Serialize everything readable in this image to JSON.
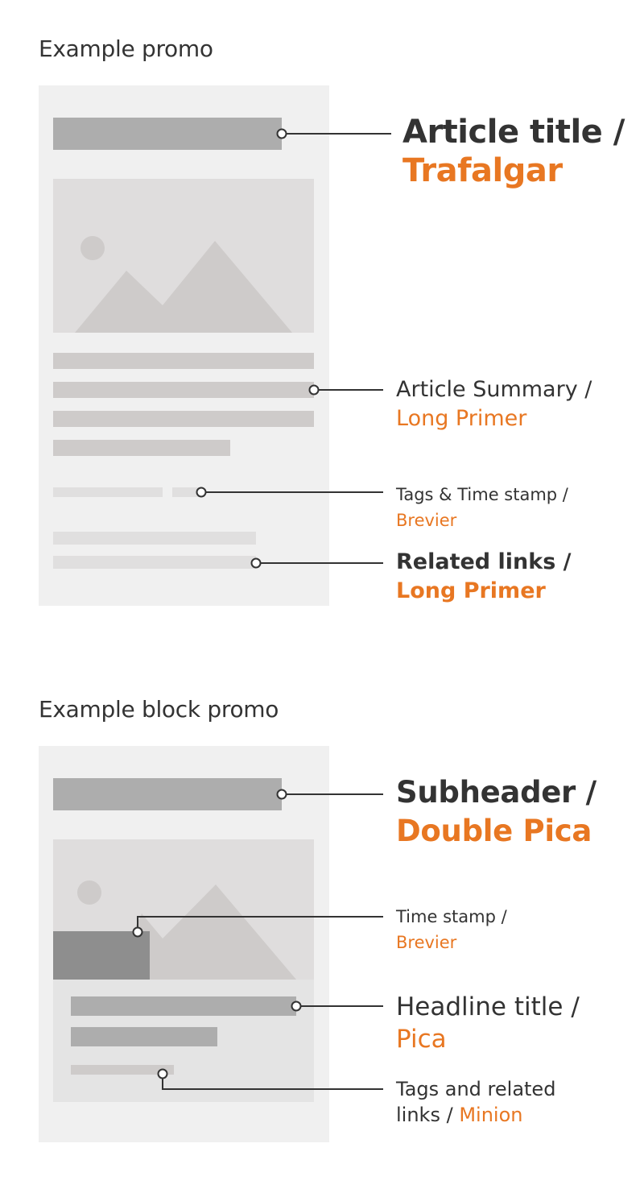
{
  "colors": {
    "text": "#333333",
    "accent": "#e87722",
    "card_bg": "#f0f0f0",
    "dark_bar": "#adadad",
    "mid_bar": "#cecbca",
    "light_bar": "#e0dfdf",
    "image_bg": "#dfdddd",
    "overlay_box": "#8e8e8e",
    "block_body": "#e4e4e4"
  },
  "promo": {
    "heading": "Example promo",
    "annotations": [
      {
        "name": "Article title",
        "sep": " /",
        "style": "Trafalgar"
      },
      {
        "name": "Article Summary",
        "sep": " /",
        "style": "Long Primer"
      },
      {
        "name": "Tags & Time stamp",
        "sep": " /",
        "style": "Brevier"
      },
      {
        "name": "Related links",
        "sep": " /",
        "style": "Long Primer"
      }
    ]
  },
  "block_promo": {
    "heading": "Example block promo",
    "annotations": [
      {
        "name": "Subheader",
        "sep": " /",
        "style": "Double Pica"
      },
      {
        "name": "Time stamp",
        "sep": " /",
        "style": "Brevier"
      },
      {
        "name": "Headline title",
        "sep": " /",
        "style": "Pica"
      },
      {
        "name": "Tags and related",
        "name2": "links /",
        "style": "Minion"
      }
    ]
  }
}
